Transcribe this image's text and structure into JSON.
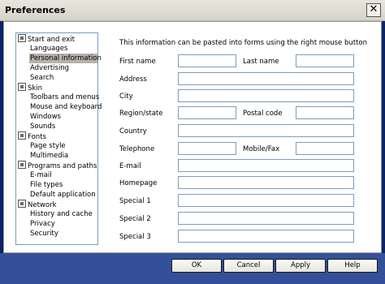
{
  "window": {
    "title": "Preferences",
    "close_label": "✕"
  },
  "tree": {
    "items": [
      {
        "label": "Start and exit",
        "type": "category",
        "icon": "settings-icon"
      },
      {
        "label": "Languages",
        "type": "child"
      },
      {
        "label": "Personal information",
        "type": "child",
        "selected": true
      },
      {
        "label": "Advertising",
        "type": "child"
      },
      {
        "label": "Search",
        "type": "child"
      },
      {
        "label": "Skin",
        "type": "category",
        "icon": "skin-icon"
      },
      {
        "label": "Toolbars and menus",
        "type": "child"
      },
      {
        "label": "Mouse and keyboard",
        "type": "child"
      },
      {
        "label": "Windows",
        "type": "child"
      },
      {
        "label": "Sounds",
        "type": "child"
      },
      {
        "label": "Fonts",
        "type": "category",
        "icon": "fonts-icon"
      },
      {
        "label": "Page style",
        "type": "child"
      },
      {
        "label": "Multimedia",
        "type": "child"
      },
      {
        "label": "Programs and paths",
        "type": "category",
        "icon": "programs-icon"
      },
      {
        "label": "E-mail",
        "type": "child"
      },
      {
        "label": "File types",
        "type": "child"
      },
      {
        "label": "Default application",
        "type": "child"
      },
      {
        "label": "Network",
        "type": "category",
        "icon": "network-icon"
      },
      {
        "label": "History and cache",
        "type": "child"
      },
      {
        "label": "Privacy",
        "type": "child"
      },
      {
        "label": "Security",
        "type": "child"
      }
    ]
  },
  "form": {
    "info": "This information can be pasted into forms using the right mouse button",
    "first_name": {
      "label": "First name",
      "value": ""
    },
    "last_name": {
      "label": "Last name",
      "value": ""
    },
    "address": {
      "label": "Address",
      "value": ""
    },
    "city": {
      "label": "City",
      "value": ""
    },
    "region": {
      "label": "Region/state",
      "value": ""
    },
    "postal": {
      "label": "Postal code",
      "value": ""
    },
    "country": {
      "label": "Country",
      "value": ""
    },
    "telephone": {
      "label": "Telephone",
      "value": ""
    },
    "mobile": {
      "label": "Mobile/Fax",
      "value": ""
    },
    "email": {
      "label": "E-mail",
      "value": ""
    },
    "homepage": {
      "label": "Homepage",
      "value": ""
    },
    "special1": {
      "label": "Special 1",
      "value": ""
    },
    "special2": {
      "label": "Special 2",
      "value": ""
    },
    "special3": {
      "label": "Special 3",
      "value": ""
    }
  },
  "buttons": {
    "ok": "OK",
    "cancel": "Cancel",
    "apply": "Apply",
    "help": "Help"
  },
  "colors": {
    "selection": "#b5b2aa",
    "field_border": "#7f9db9",
    "footer": "#34509a"
  }
}
